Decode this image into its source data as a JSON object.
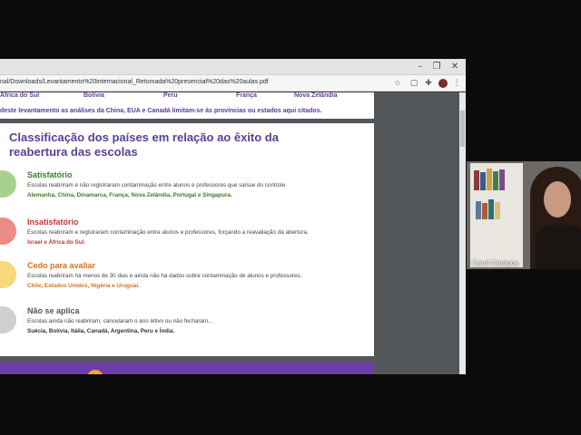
{
  "browser": {
    "url": "nal/Downloads/Levantamento%20internacional_Retomada%20presencial%20das%20aulas.pdf",
    "minimize_glyph": "–",
    "maximize_glyph": "❐",
    "close_glyph": "✕",
    "star_glyph": "☆",
    "menu_glyph": "⋮"
  },
  "pdf": {
    "countries_row": [
      "África do Sul",
      "Bolívia",
      "Peru",
      "França",
      "Nova Zelândia"
    ],
    "note": "deste levantamento as análises da China, EUA e Canadá limitam-se às províncias ou estados aqui citados.",
    "heading": "Classificação dos países em relação ao êxito da reabertura das escolas",
    "categories": [
      {
        "title": "Satisfatório",
        "description": "Escolas reabriram e não registraram contaminação entre alunos e professores que saísse do controle.",
        "countries": "Alemanha, China, Dinamarca, França, Nova Zelândia, Portugal e Singapura.",
        "color": "#a8d08d",
        "title_color": "#3a7d2a"
      },
      {
        "title": "Insatisfatório",
        "description": "Escolas reabriram e registraram contaminação entre alunos e professores, forçando a reavaliação da abertura.",
        "countries": "Israel e África do Sul.",
        "color": "#ec8c86",
        "title_color": "#c0392b"
      },
      {
        "title": "Cedo para avaliar",
        "description": "Escolas reabriram há menos de 30 dias e ainda não há dados sobre contaminação de alunos e professores.",
        "countries": "Chile,  Estados Unidos, Nigéria e Uruguai.",
        "color": "#f7d87a",
        "title_color": "#d4731d"
      },
      {
        "title": "Não se aplica",
        "description": "Escolas ainda não reabriram, cancelaram o ano letivo ou não fecharam...",
        "countries": "Suécia, Bolívia, Itália, Canadá, Argentina, Peru e Índia.",
        "color": "#cfcfcf",
        "title_color": "#555555"
      }
    ]
  },
  "webcam": {
    "participant_name": "Carol Campos"
  }
}
